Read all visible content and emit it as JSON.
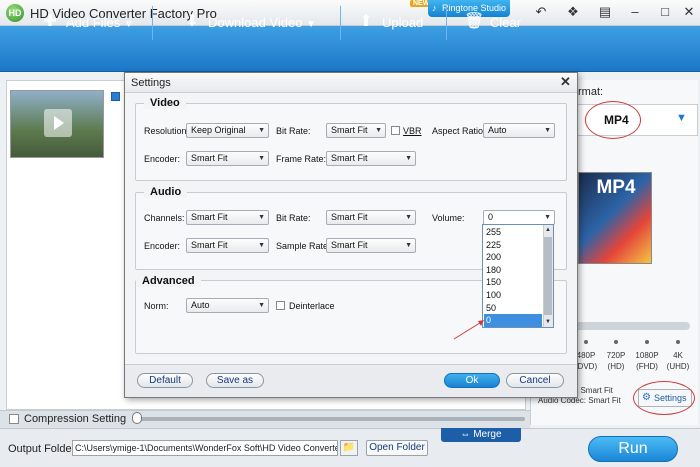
{
  "app": {
    "logo_text": "HD",
    "title": "HD Video Converter Factory Pro",
    "new_badge": "NEW",
    "ringtone_label": "Ringtone Studio"
  },
  "toolbar": {
    "add_files": "Add Files",
    "download_video": "Download Video",
    "upload": "Upload",
    "clear": "Clear"
  },
  "right_panel": {
    "format_label": "rmat:",
    "format_value": "MP4",
    "art_label": "MP4",
    "qualities": [
      "480P\n(DVD)",
      "720P\n(HD)",
      "1080P\n(FHD)",
      "4K\n(UHD)"
    ],
    "codec_lines": [
      ": Smart Fit",
      "Audio Codec: Smart Fit"
    ],
    "settings_label": "Settings"
  },
  "compression": {
    "label": "Compression Setting"
  },
  "bottom": {
    "output_label": "Output Folder:",
    "output_path": "C:\\Users\\ymige-1\\Documents\\WonderFox Soft\\HD Video Converter Factory P",
    "open_folder": "Open Folder",
    "merge": "Merge",
    "run": "Run"
  },
  "dialog": {
    "title": "Settings",
    "video": {
      "group": "Video",
      "resolution_label": "Resolution:",
      "resolution_value": "Keep Original",
      "bitrate_label": "Bit Rate:",
      "bitrate_value": "Smart Fit",
      "vbr_label": "VBR",
      "aspect_label": "Aspect Ratio:",
      "aspect_value": "Auto",
      "encoder_label": "Encoder:",
      "encoder_value": "Smart Fit",
      "framerate_label": "Frame Rate:",
      "framerate_value": "Smart Fit"
    },
    "audio": {
      "group": "Audio",
      "channels_label": "Channels:",
      "channels_value": "Smart Fit",
      "bitrate_label": "Bit Rate:",
      "bitrate_value": "Smart Fit",
      "volume_label": "Volume:",
      "volume_value": "0",
      "encoder_label": "Encoder:",
      "encoder_value": "Smart Fit",
      "samplerate_label": "Sample Rate:",
      "samplerate_value": "Smart Fit",
      "volume_options": [
        "255",
        "225",
        "200",
        "180",
        "150",
        "100",
        "50",
        "0"
      ],
      "volume_selected": "0"
    },
    "advanced": {
      "group": "Advanced",
      "norm_label": "Norm:",
      "norm_value": "Auto",
      "deinterlace_label": "Deinterlace"
    },
    "buttons": {
      "default": "Default",
      "save_as": "Save as",
      "ok": "Ok",
      "cancel": "Cancel"
    }
  },
  "colors": {
    "accent": "#1c78c8",
    "annotation": "#d23a3a",
    "selected": "#3f8fe0"
  }
}
